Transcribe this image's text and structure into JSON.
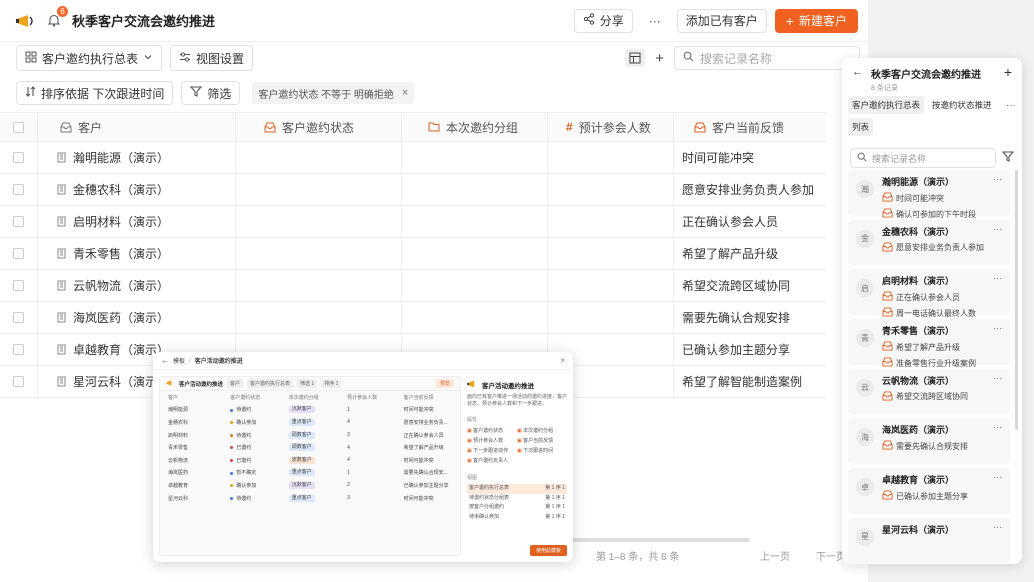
{
  "header": {
    "notification_count": "6",
    "title": "秋季客户交流会邀约推进",
    "share_label": "分享",
    "more_label": "···",
    "add_existing_label": "添加已有客户",
    "new_customer_label": "新建客户"
  },
  "toolbar": {
    "table_name": "客户邀约执行总表",
    "view_settings_label": "视图设置",
    "search_placeholder": "搜索记录名称",
    "sort_label": "排序依据 下次跟进时间",
    "filter_label": "筛选",
    "filter_tag": "客户邀约状态 不等于 明确拒绝"
  },
  "grid": {
    "columns": [
      "客户",
      "客户邀约状态",
      "本次邀约分组",
      "预计参会人数",
      "客户当前反馈"
    ],
    "rows": [
      {
        "name": "瀚明能源（演示）",
        "feedback": "时间可能冲突"
      },
      {
        "name": "金穗农科（演示）",
        "feedback": "愿意安排业务负责人参加"
      },
      {
        "name": "启明材料（演示）",
        "feedback": "正在确认参会人员"
      },
      {
        "name": "青禾零售（演示）",
        "feedback": "希望了解产品升级"
      },
      {
        "name": "云帆物流（演示）",
        "feedback": "希望交流跨区域协同"
      },
      {
        "name": "海岚医药（演示）",
        "feedback": "需要先确认合规安排"
      },
      {
        "name": "卓越教育（演示）",
        "feedback": "已确认参加主题分享"
      },
      {
        "name": "星河云科（演示）",
        "feedback": "希望了解智能制造案例"
      }
    ]
  },
  "pager": {
    "summary": "第 1–8 条，共 8 条",
    "prev": "上一页",
    "next": "下一页"
  },
  "modal": {
    "breadcrumb_root": "模板",
    "breadcrumb_sep": "/",
    "breadcrumb_current": "客户活动邀约推进",
    "close": "×",
    "preview_title": "客户活动邀约推进",
    "preview_chips": [
      "客户",
      "客户邀约执行总表",
      "筛选 1",
      "排序 1"
    ],
    "preview_use_small": "预览",
    "preview_columns": [
      "客户",
      "客户邀约状态",
      "本次邀约分组",
      "预计参会人数",
      "客户当前反馈"
    ],
    "preview_rows": [
      {
        "name": "瀚明能源",
        "status": "待邀约",
        "status_color": "#3a7be0",
        "group": "沉默客户",
        "group_bg": "#e6ddf7",
        "num": "1",
        "fb": "时间可能冲突"
      },
      {
        "name": "金穗农科",
        "status": "确认参加",
        "status_color": "#e0a21e",
        "group": "重点客户",
        "group_bg": "#dbe8fb",
        "num": "4",
        "fb": "愿意安排业务负责..."
      },
      {
        "name": "启明材料",
        "status": "待邀约",
        "status_color": "#e07b1e",
        "group": "頭数客户",
        "group_bg": "#dbe8fb",
        "num": "3",
        "fb": "正在确认参会人员"
      },
      {
        "name": "青禾零售",
        "status": "已邀约",
        "status_color": "#d64545",
        "group": "頭数客户",
        "group_bg": "#dbe8fb",
        "num": "4",
        "fb": "希望了解产品升级"
      },
      {
        "name": "云帆物流",
        "status": "已邀约",
        "status_color": "#d64545",
        "group": "流数客户",
        "group_bg": "#f7e3d3",
        "num": "4",
        "fb": "时间可能冲突"
      },
      {
        "name": "海岚医药",
        "status": "暂不确定",
        "status_color": "#3a7be0",
        "group": "重点客户",
        "group_bg": "#dbe8fb",
        "num": "1",
        "fb": "需要先确认合规安..."
      },
      {
        "name": "卓越教育",
        "status": "确认参加",
        "status_color": "#e0a21e",
        "group": "沉默客户",
        "group_bg": "#e6ddf7",
        "num": "2",
        "fb": "已确认参加主题分享"
      },
      {
        "name": "星河云科",
        "status": "待邀约",
        "status_color": "#3a7be0",
        "group": "重点客户",
        "group_bg": "#dbe8fb",
        "num": "3",
        "fb": "时间可能冲突"
      }
    ],
    "info_title": "客户活动邀约推进",
    "info_desc": "面向已有客户推进一场活动的邀约进度，客户状态、预计参会人数和下一步跟进。",
    "props_heading": "属性",
    "props": [
      "客户邀约状态",
      "本次邀约分组",
      "预计参会人数",
      "客户当前反馈",
      "下一步跟进动作",
      "下次跟进时间",
      "客户邀约负责人"
    ],
    "views_heading": "视图",
    "views": [
      {
        "name": "客户邀约执行总表",
        "meta": "第 1 序 1"
      },
      {
        "name": "待邀约状态分组表",
        "meta": "第 1 序 1"
      },
      {
        "name": "按客户分组邀约",
        "meta": "第 1 序 1"
      },
      {
        "name": "待未确认参加",
        "meta": "第 1 序 1"
      }
    ],
    "use_label": "使用此模板"
  },
  "panel": {
    "title": "秋季客户交流会邀约推进",
    "count": "8 条记录",
    "tabs": [
      "客户邀约执行总表",
      "按邀约状态推进",
      "列表"
    ],
    "tab_more": "···",
    "search_placeholder": "搜索记录名称",
    "cards": [
      {
        "avatar": "瀚",
        "name": "瀚明能源（演示）",
        "lines": [
          "时间可能冲突",
          "确认可参加的下午时段"
        ]
      },
      {
        "avatar": "金",
        "name": "金穗农科（演示）",
        "lines": [
          "愿意安排业务负责人参加"
        ]
      },
      {
        "avatar": "启",
        "name": "启明材料（演示）",
        "lines": [
          "正在确认参会人员",
          "周一电话确认最终人数"
        ]
      },
      {
        "avatar": "青",
        "name": "青禾零售（演示）",
        "lines": [
          "希望了解产品升级",
          "准备零售行业升级案例"
        ]
      },
      {
        "avatar": "云",
        "name": "云帆物流（演示）",
        "lines": [
          "希望交流跨区域协同"
        ]
      },
      {
        "avatar": "海",
        "name": "海岚医药（演示）",
        "lines": [
          "需要先确认合规安排"
        ]
      },
      {
        "avatar": "卓",
        "name": "卓越教育（演示）",
        "lines": [
          "已确认参加主题分享"
        ]
      },
      {
        "avatar": "星",
        "name": "星河云科（演示）",
        "lines": []
      }
    ]
  },
  "colors": {
    "accent": "#f0601e",
    "icon_orange": "#e0601e"
  }
}
